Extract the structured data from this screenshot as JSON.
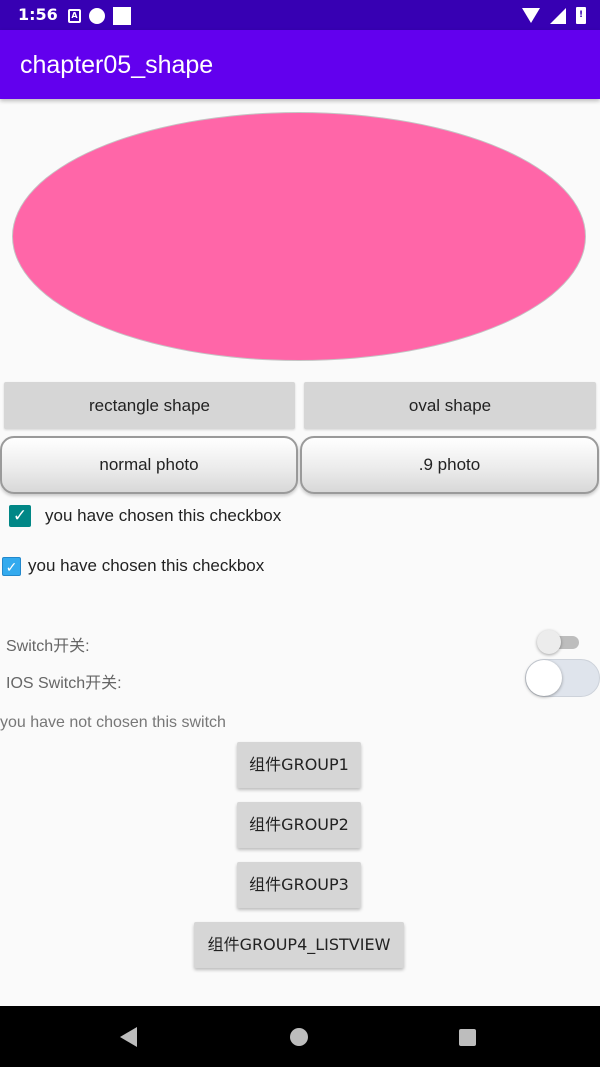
{
  "status_bar": {
    "time": "1:56",
    "left_icons": [
      "a-letter-icon",
      "circle-dot-icon",
      "square-icon"
    ],
    "a_icon_letter": "A",
    "right_icons": [
      "wifi-icon",
      "signal-icon",
      "battery-icon"
    ],
    "battery_glyph": "!"
  },
  "app_bar": {
    "title": "chapter05_shape"
  },
  "colors": {
    "status_bar": "#3700b3",
    "app_bar": "#6200ee",
    "oval_fill": "#ff66a8",
    "checkbox_primary": "#018786",
    "checkbox_secondary": "#33aaee",
    "button_gray": "#d6d6d6"
  },
  "shape_buttons": {
    "rectangle": "rectangle shape",
    "oval": "oval shape"
  },
  "photo_buttons": {
    "normal": "normal photo",
    "nine_patch": ".9 photo"
  },
  "checkboxes": [
    {
      "label": "you have chosen this checkbox",
      "checked": true
    },
    {
      "label": "you have chosen this checkbox",
      "checked": true
    }
  ],
  "switches": [
    {
      "label": "Switch开关:",
      "on": false
    },
    {
      "label": "IOS Switch开关:",
      "on": false
    }
  ],
  "switch_status": "you have not chosen this switch",
  "group_buttons": [
    "组件GROUP1",
    "组件GROUP2",
    "组件GROUP3",
    "组件GROUP4_LISTVIEW"
  ],
  "nav_bar": {
    "icons": [
      "back-icon",
      "home-icon",
      "recents-icon"
    ]
  }
}
